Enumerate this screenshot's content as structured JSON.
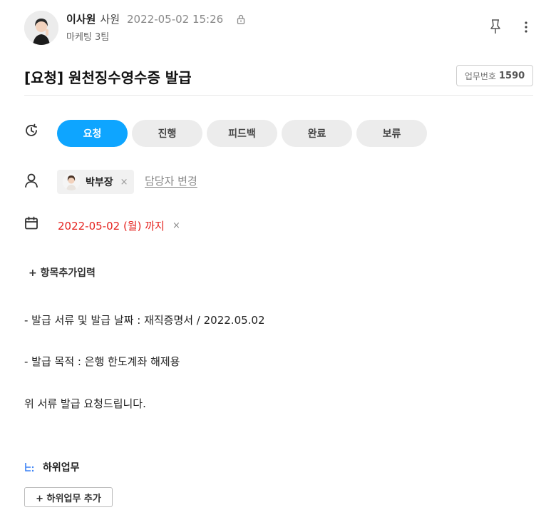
{
  "post": {
    "author_name": "이사원",
    "author_role": "사원",
    "timestamp": "2022-05-02 15:26",
    "team": "마케팅 3팀",
    "privacy_icon": "lock-icon",
    "pin_icon": "pin-icon",
    "more_icon": "more-vertical-icon"
  },
  "task": {
    "title": "[요청] 원천징수영수증 발급",
    "number_label": "업무번호",
    "number": "1590"
  },
  "status": {
    "icon": "status-clock-icon",
    "active": "요청",
    "options": [
      {
        "label": "요청",
        "active": true
      },
      {
        "label": "진행",
        "active": false
      },
      {
        "label": "피드백",
        "active": false
      },
      {
        "label": "완료",
        "active": false
      },
      {
        "label": "보류",
        "active": false
      }
    ],
    "active_color": "#0ea5ff"
  },
  "assignee": {
    "icon": "person-icon",
    "name": "박부장",
    "remove": "×",
    "change_label": "담당자 변경"
  },
  "due": {
    "icon": "calendar-icon",
    "text": "2022-05-02 (월) 까지",
    "remove": "×",
    "color": "#e5231f"
  },
  "add_item_label": "+ 항목추가입력",
  "body_lines": [
    "- 발급 서류 및 발급 날짜 : 재직증명서 / 2022.05.02",
    "- 발급 목적 : 은행 한도계좌 해제용",
    "위 서류 발급 요청드립니다."
  ],
  "subtask": {
    "icon": "subtask-icon",
    "title": "하위업무",
    "add_label": "+ 하위업무 추가"
  }
}
